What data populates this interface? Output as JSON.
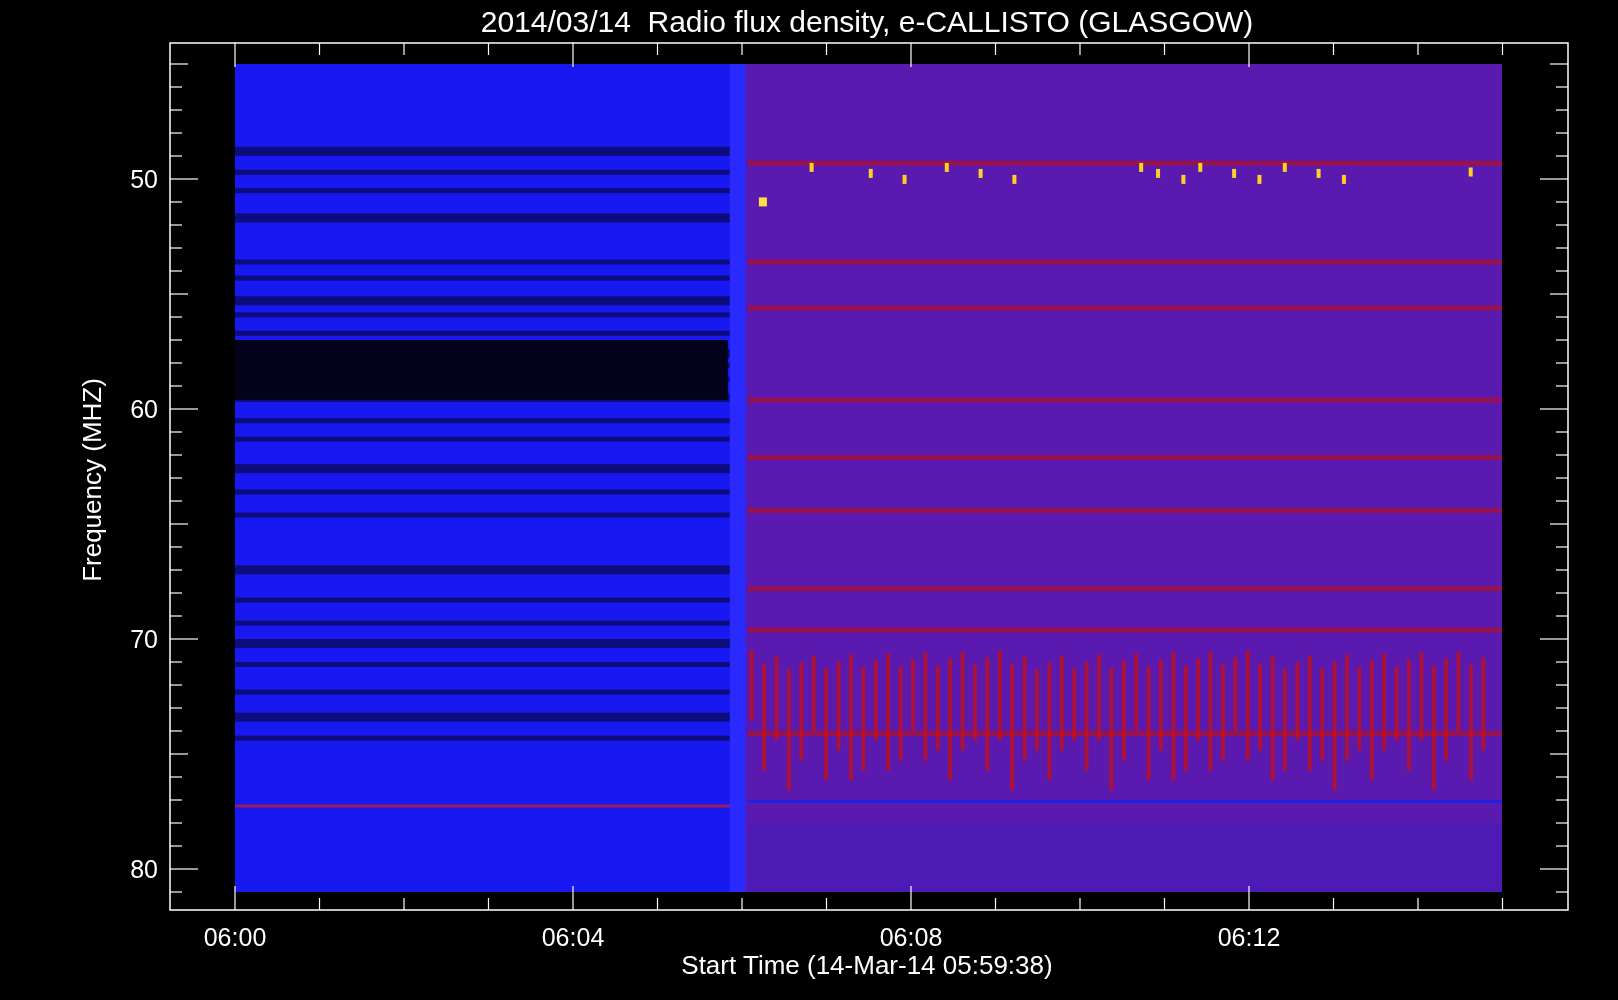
{
  "title": "2014/03/14  Radio flux density, e-CALLISTO (GLASGOW)",
  "y_axis": {
    "label": "Frequency (MHZ)",
    "ticks": [
      "50",
      "60",
      "70",
      "80"
    ]
  },
  "x_axis": {
    "label": "Start Time (14-Mar-14 05:59:38)",
    "ticks": [
      "06:00",
      "06:04",
      "06:08",
      "06:12"
    ]
  }
}
